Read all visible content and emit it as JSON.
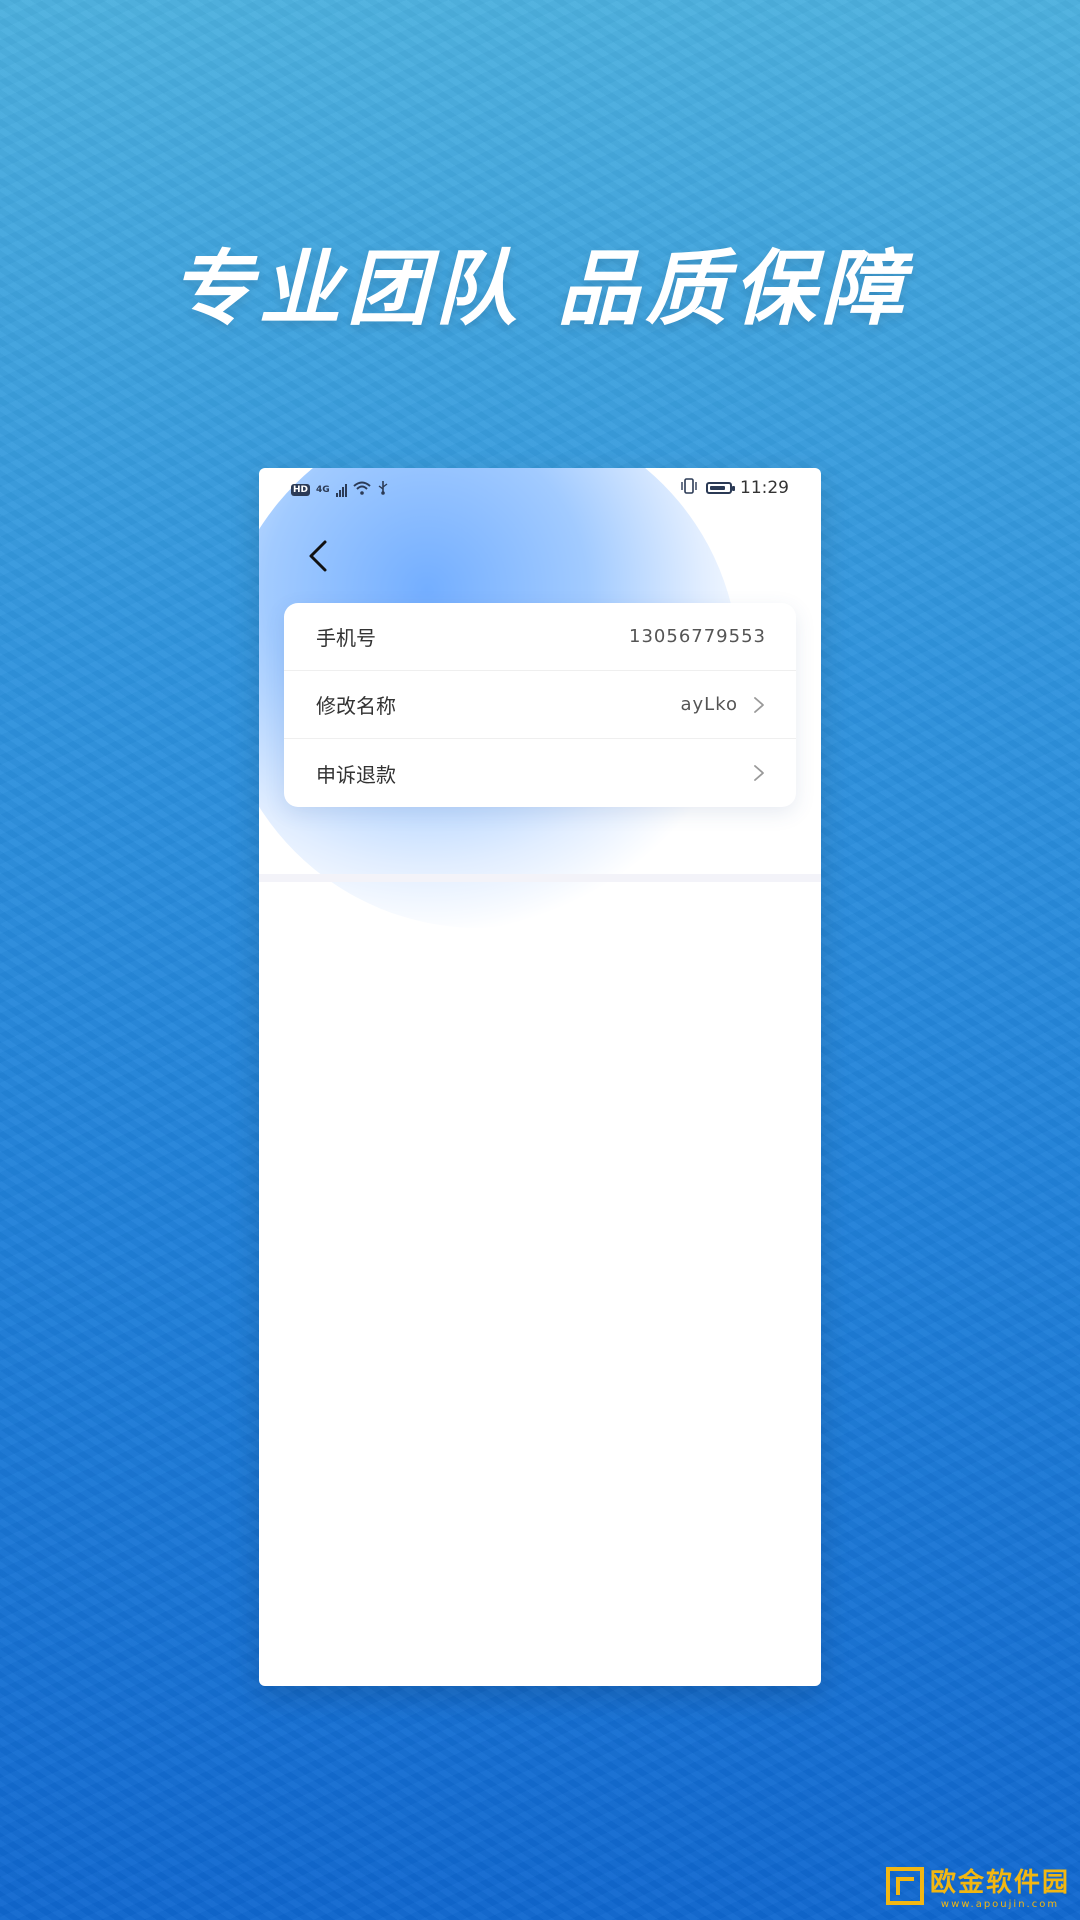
{
  "headline": "专业团队 品质保障",
  "statusbar": {
    "network": "4G",
    "hd": "HD",
    "time": "11:29",
    "battery_level": 0.85
  },
  "icons": {
    "back": "chevron-left-icon",
    "row_arrow": "chevron-right-icon"
  },
  "settings": {
    "rows": [
      {
        "label": "手机号",
        "value": "13056779553",
        "has_arrow": false
      },
      {
        "label": "修改名称",
        "value": "ayLko",
        "has_arrow": true
      },
      {
        "label": "申诉退款",
        "value": "",
        "has_arrow": true
      }
    ]
  },
  "watermark": {
    "name": "欧金软件园",
    "url": "www.apoujin.com"
  },
  "colors": {
    "background_top": "#4cb0de",
    "background_bottom": "#0f67cf",
    "accent_glow": "#6caaff",
    "watermark": "#f2b712"
  }
}
